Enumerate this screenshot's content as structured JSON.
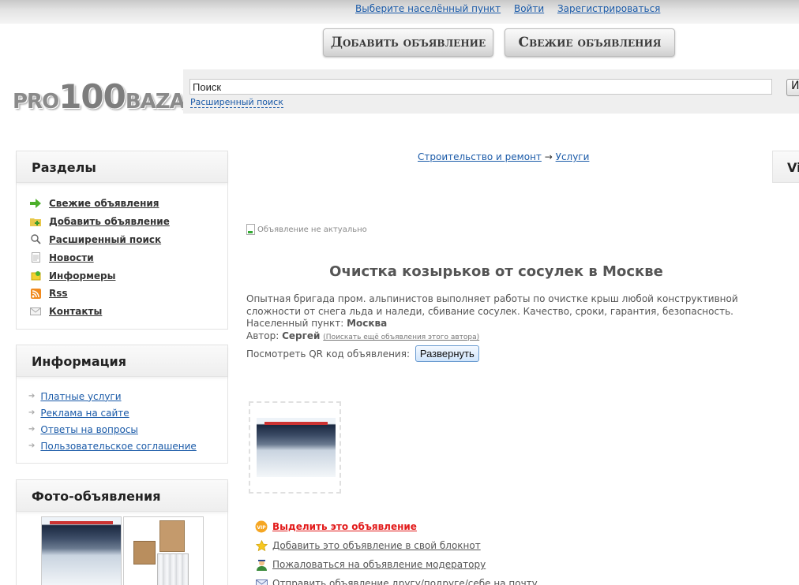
{
  "top_links": {
    "choose_city": "Выберите населённый пункт",
    "login": "Войти",
    "register": "Зарегистрироваться"
  },
  "buttons": {
    "add": "Добавить объявление",
    "fresh": "Свежие объявления"
  },
  "logo": {
    "part1": "PRO",
    "part2": "100",
    "part3": "BAZA"
  },
  "search": {
    "value": "Поиск",
    "button": "Искать",
    "advanced": "Расширенный поиск"
  },
  "sections": {
    "title": "Разделы",
    "items": [
      {
        "label": "Свежие объявления",
        "icon": "green-arrow-icon"
      },
      {
        "label": "Добавить объявление",
        "icon": "add-folder-icon"
      },
      {
        "label": "Расширенный поиск",
        "icon": "magnifier-icon"
      },
      {
        "label": "Новости",
        "icon": "document-icon"
      },
      {
        "label": "Информеры",
        "icon": "informer-icon"
      },
      {
        "label": "Rss",
        "icon": "rss-icon"
      },
      {
        "label": "Контакты",
        "icon": "envelope-icon"
      }
    ]
  },
  "information": {
    "title": "Информация",
    "items": [
      "Платные услуги",
      "Реклама на сайте",
      "Ответы на вопросы",
      "Пользовательское соглашение"
    ]
  },
  "photo_ads": {
    "title": "Фото-объявления"
  },
  "right_panel": {
    "title": "Vi"
  },
  "breadcrumb": {
    "cat": "Строительство и ремонт",
    "sep": "→",
    "sub": "Услуги"
  },
  "ad": {
    "status": "Объявление не актуально",
    "title": "Очистка козырьков от сосулек в Москве",
    "description": "Опытная бригада пром. альпинистов выполняет работы по очистке крыш любой конструктивной сложности от снега льда и наледи, сбивание сосулек. Качество, сроки, гарантия, безопасность.",
    "city_label": "Населенный пункт:",
    "city": "Москва",
    "author_label": "Автор:",
    "author": "Сергей",
    "author_more": "(Поискать ещё объявления этого автора)",
    "qr_label": "Посмотреть QR код объявления:",
    "qr_button": "Развернуть"
  },
  "actions": [
    {
      "label": "Выделить это объявление",
      "icon": "vip-icon"
    },
    {
      "label": "Добавить это объявление в свой блокнот",
      "icon": "star-icon"
    },
    {
      "label": "Пожаловаться на объявление модератору",
      "icon": "moderator-icon"
    },
    {
      "label": "Отправить объявление другу/подруге/себе на почту",
      "icon": "mail-icon"
    }
  ],
  "colors": {
    "link": "#1a5aa8",
    "highlight": "#e21b1b"
  }
}
